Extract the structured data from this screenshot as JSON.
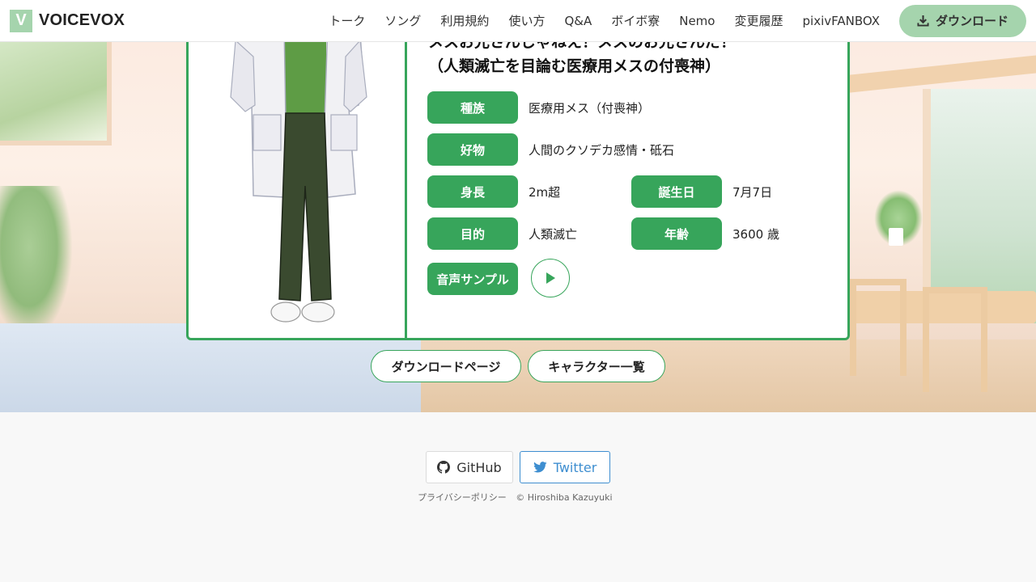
{
  "header": {
    "logo_letter": "V",
    "brand": "VOICEVOX",
    "nav": [
      "トーク",
      "ソング",
      "利用規約",
      "使い方",
      "Q&A",
      "ボイボ寮",
      "Nemo",
      "変更履歴",
      "pixivFANBOX"
    ],
    "download_label": "ダウンロード"
  },
  "character": {
    "catch_line1": "メスお兄さんじゃねえ！メスのお兄さんだ！",
    "catch_line2": "（人類滅亡を目論む医療用メスの付喪神）",
    "species_label": "種族",
    "species": "医療用メス（付喪神）",
    "likes_label": "好物",
    "likes": "人間のクソデカ感情・砥石",
    "height_label": "身長",
    "height": "2m超",
    "birthday_label": "誕生日",
    "birthday": "7月7日",
    "goal_label": "目的",
    "goal": "人類滅亡",
    "age_label": "年齢",
    "age": "3600 歳",
    "sample_label": "音声サンプル"
  },
  "links": {
    "download_page": "ダウンロードページ",
    "character_list": "キャラクター一覧"
  },
  "footer": {
    "github": "GitHub",
    "twitter": "Twitter",
    "privacy": "プライバシーポリシー",
    "copyright": "© Hiroshiba Kazuyuki"
  },
  "colors": {
    "accent": "#37a55b",
    "accent_light": "#a5d4ad",
    "twitter": "#3e8ed0"
  },
  "icons": [
    "download-icon",
    "play-icon",
    "github-icon",
    "twitter-icon"
  ]
}
